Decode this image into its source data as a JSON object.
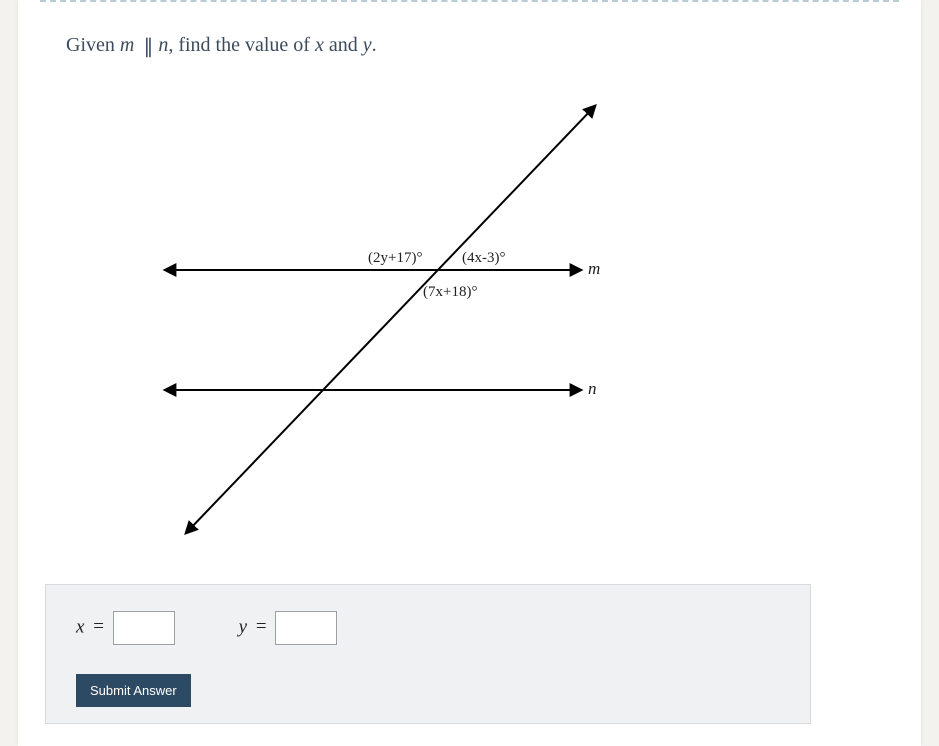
{
  "prompt": {
    "before": "Given ",
    "m": "m",
    "parallel": "∥",
    "n": "n",
    "after1": ", find the value of ",
    "x": "x",
    "and": " and ",
    "y": "y",
    "period": "."
  },
  "figure": {
    "angles": {
      "top_left": "(2y+17)°",
      "top_right": "(4x-3)°",
      "below": "(7x+18)°"
    },
    "line_m": "m",
    "line_n": "n"
  },
  "answer": {
    "x_label": "x",
    "y_label": "y",
    "eq": "=",
    "x_value": "",
    "y_value": "",
    "submit": "Submit Answer"
  },
  "chart_data": {
    "type": "diagram",
    "description": "Two horizontal parallel lines m (upper) and n (lower) cut by a transversal. At the intersection with line m, the angle on the upper-left of the transversal is (2y+17)°, the angle on the upper-right is (4x-3)°, and the angle on the lower-right (below line m, right of transversal) is (7x+18)°.",
    "labeled_angles": [
      {
        "position": "upper-left of transversal at line m",
        "expression": "(2y+17)°"
      },
      {
        "position": "upper-right of transversal at line m",
        "expression": "(4x-3)°"
      },
      {
        "position": "lower-right of transversal at line m",
        "expression": "(7x+18)°"
      }
    ],
    "lines": [
      "m",
      "n"
    ],
    "relation": "m ∥ n"
  }
}
